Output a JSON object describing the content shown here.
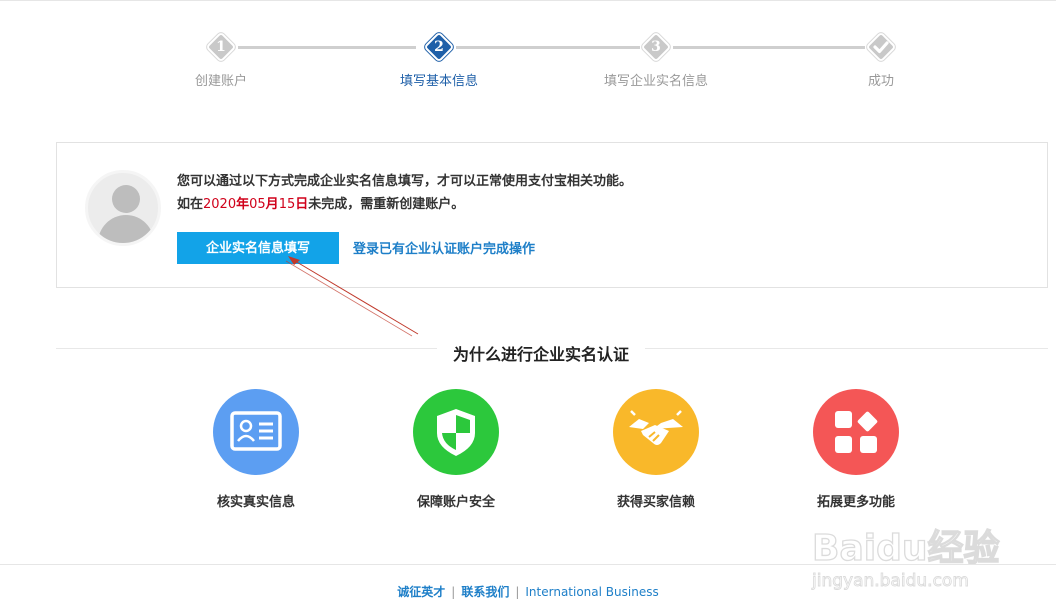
{
  "steps": [
    {
      "num": "1",
      "label": "创建账户"
    },
    {
      "num": "2",
      "label": "填写基本信息"
    },
    {
      "num": "3",
      "label": "填写企业实名信息"
    },
    {
      "num": "",
      "label": "成功"
    }
  ],
  "notice": {
    "line1": "您可以通过以下方式完成企业实名信息填写，才可以正常使用支付宝相关功能。",
    "line2_prefix": "如在",
    "date_year": "2020",
    "date_year_suffix": "年",
    "date_month": "05",
    "date_month_suffix": "月",
    "date_day": "15",
    "date_day_suffix": "日",
    "line2_suffix": "未完成，需重新创建账户。",
    "primary_button": "企业实名信息填写",
    "alt_link": "登录已有企业认证账户完成操作"
  },
  "why": {
    "title": "为什么进行企业实名认证",
    "features": [
      {
        "label": "核实真实信息",
        "icon": "id-card-icon",
        "color": "#5c9ef2"
      },
      {
        "label": "保障账户安全",
        "icon": "shield-icon",
        "color": "#2cc83c"
      },
      {
        "label": "获得买家信赖",
        "icon": "handshake-icon",
        "color": "#f9b82a"
      },
      {
        "label": "拓展更多功能",
        "icon": "apps-icon",
        "color": "#f45656"
      }
    ]
  },
  "footer": {
    "link1": "诚征英才",
    "link2": "联系我们",
    "link3": "International Business"
  },
  "watermark": {
    "brand": "Baidu经验",
    "url": "jingyan.baidu.com"
  }
}
